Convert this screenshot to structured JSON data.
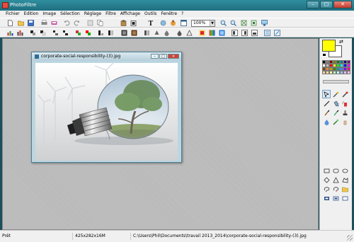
{
  "app": {
    "title": "PhotoFiltre"
  },
  "menu": [
    "Fichier",
    "Edition",
    "Image",
    "Sélection",
    "Réglage",
    "Filtre",
    "Affichage",
    "Outils",
    "Fenêtre",
    "?"
  ],
  "toolbar": {
    "zoom_value": "100%"
  },
  "document": {
    "title": "corporate-social-responsibility-(3).jpg"
  },
  "status": {
    "state": "Prêt",
    "image_info": "425x282x16M",
    "file_path": "C:\\Users\\Phil\\Documents\\travail 2013_2014\\corporate-social-responsibility-(3).jpg"
  },
  "colors": {
    "foreground": "#ffff00",
    "background": "#ffffff",
    "palette": [
      "#000000",
      "#808080",
      "#800000",
      "#808000",
      "#008000",
      "#008080",
      "#000080",
      "#800080",
      "#ffffff",
      "#c0c0c0",
      "#ff0000",
      "#ffff00",
      "#00ff00",
      "#00ffff",
      "#0000ff",
      "#ff00ff",
      "#804000",
      "#ff8040",
      "#c0a000",
      "#408000",
      "#00a0a0",
      "#4080ff",
      "#8000ff",
      "#ff0080",
      "#ffcc99",
      "#ffe0a0",
      "#ffffa0",
      "#c0ffc0",
      "#c0ffff",
      "#a0c0ff",
      "#e0c0ff",
      "#ffc0e0"
    ]
  },
  "icons": {
    "toolbar1": [
      "new-icon",
      "open-icon",
      "save-icon",
      "print-icon",
      "scan-icon",
      "undo-icon",
      "redo-icon",
      "cut-icon",
      "copy-icon",
      "paste-icon",
      "paste-new-icon",
      "text-icon",
      "stamp-icon",
      "automation-icon",
      "window-icon",
      "zoom-in-icon",
      "zoom-out-icon",
      "zoom-100-icon",
      "fit-window-icon",
      "monitor-icon"
    ],
    "toolbar2": [
      "auto-levels-icon",
      "auto-contrast-icon",
      "brightness-minus-icon",
      "brightness-plus-icon",
      "contrast-minus-icon",
      "contrast-plus-icon",
      "saturation-minus-icon",
      "saturation-plus-icon",
      "gamma-minus-icon",
      "gamma-plus-icon",
      "grayscale-icon",
      "sepia-icon",
      "blur-icon",
      "sharpen-icon",
      "drop-icon",
      "drop-plus-icon",
      "triangle-icon",
      "effect-icon",
      "gradient-icon",
      "rgb-icon",
      "flip-h-icon",
      "flip-v-icon",
      "rotate-icon",
      "rotate-ccw-icon",
      "resize-icon"
    ],
    "tools": [
      "selection-tool-icon",
      "magic-wand-icon",
      "eyedropper-icon",
      "line-tool-icon",
      "fill-bucket-icon",
      "spray-icon",
      "brush-icon",
      "advanced-brush-icon",
      "clone-stamp-icon",
      "blur-tool-icon",
      "smudge-icon",
      "finger-icon"
    ],
    "shapes": [
      "rectangle-shape-icon",
      "rounded-rect-shape-icon",
      "ellipse-shape-icon",
      "diamond-shape-icon",
      "triangle-shape-icon",
      "polygon-shape-icon",
      "lasso-icon",
      "magnetic-lasso-icon",
      "folder-shape-icon",
      "select-all-icon",
      "invert-selection-icon",
      "hide-selection-icon"
    ]
  }
}
